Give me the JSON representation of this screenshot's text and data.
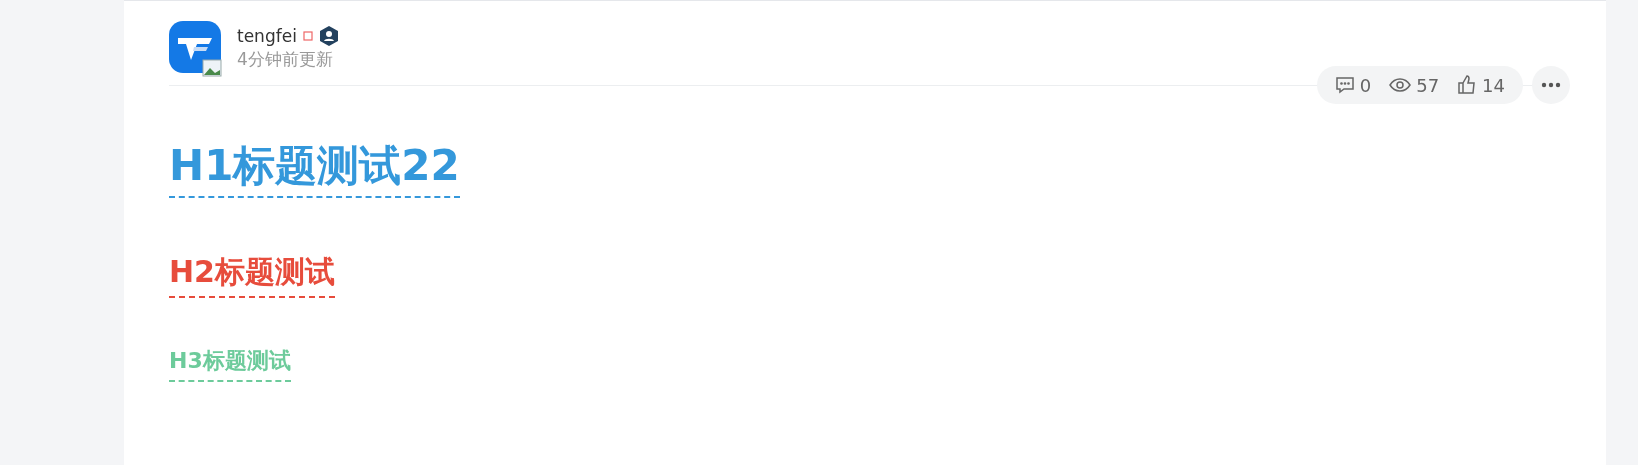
{
  "author": {
    "name": "tengfei",
    "updated": "4分钟前更新"
  },
  "stats": {
    "comments": "0",
    "views": "57",
    "likes": "14"
  },
  "headings": [
    {
      "kind": "h1",
      "text": "H1标题测试22",
      "color": "#3498db"
    },
    {
      "kind": "h2",
      "text": "H2标题测试",
      "color": "#e74c3c"
    },
    {
      "kind": "h3",
      "text": "H3标题测试",
      "color": "#6dcb9b"
    }
  ]
}
